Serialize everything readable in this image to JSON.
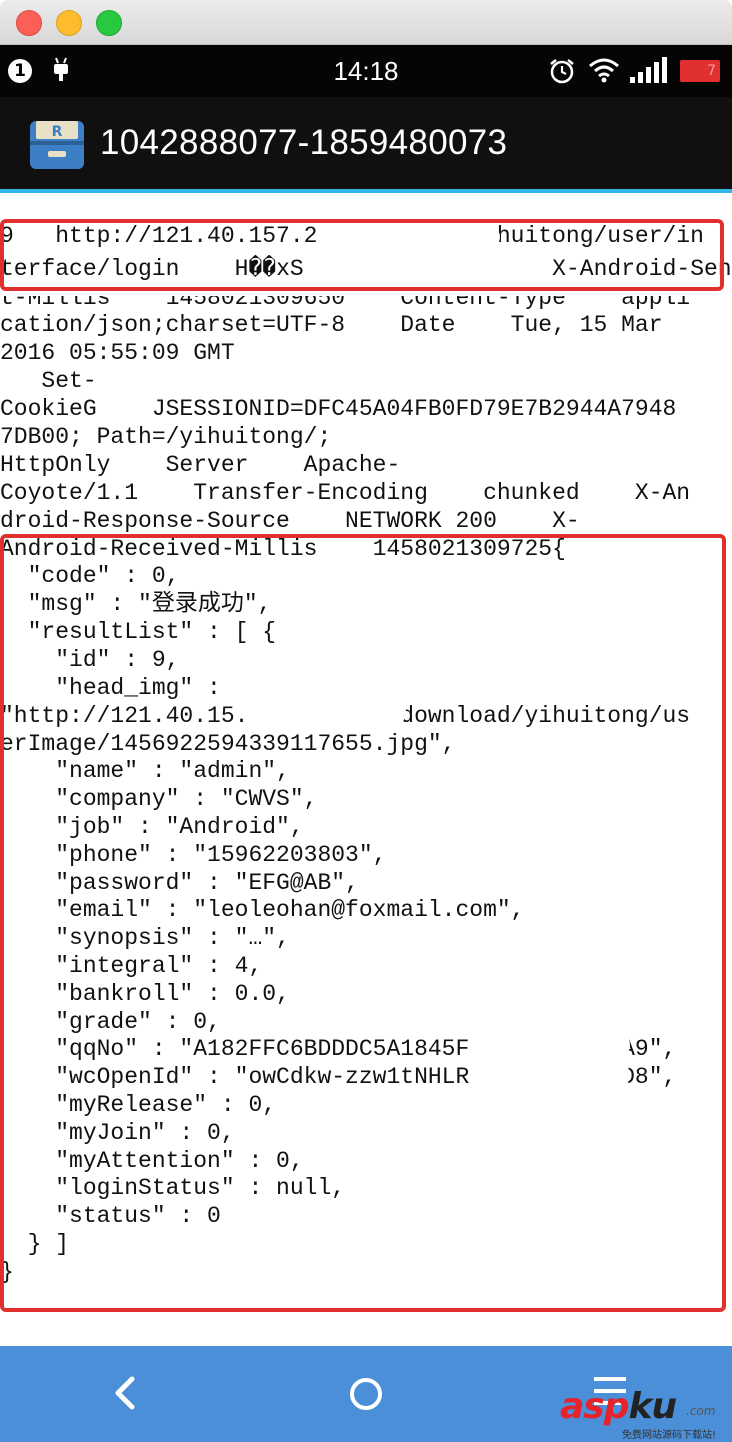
{
  "status_bar": {
    "notification_count": "1",
    "time": "14:18",
    "battery_level": "7"
  },
  "action_bar": {
    "title": "1042888077-1859480073"
  },
  "response_lines": [
    "9   http://121.40.157.2           yihuitong/user/in",
    "terface/login    H��xS                  X-Android-Sen",
    "t-Millis    1458021309650    Content-Type    appli",
    "cation/json;charset=UTF-8    Date    Tue, 15 Mar",
    "2016 05:55:09 GMT",
    "   Set-",
    "CookieG    JSESSIONID=DFC45A04FB0FD79E7B2944A7948",
    "7DB00; Path=/yihuitong/;",
    "HttpOnly    Server    Apache-",
    "Coyote/1.1    Transfer-Encoding    chunked    X-An",
    "droid-Response-Source    NETWORK 200    X-",
    "Android-Received-Millis    1458021309725{",
    "  \"code\" : 0,",
    "  \"msg\" : \"登录成功\",",
    "  \"resultList\" : [ {",
    "    \"id\" : 9,",
    "    \"head_img\" :",
    "\"http://121.40.15.          /download/yihuitong/us",
    "erImage/1456922594339117655.jpg\",",
    "    \"name\" : \"admin\",",
    "    \"company\" : \"CWVS\",",
    "    \"job\" : \"Android\",",
    "    \"phone\" : \"15962203803\",",
    "    \"password\" : \"EFG@AB\",",
    "    \"email\" : \"leoleohan@foxmail.com\",",
    "    \"synopsis\" : \"…\",",
    "    \"integral\" : 4,",
    "    \"bankroll\" : 0.0,",
    "    \"grade\" : 0,",
    "    \"qqNo\" : \"A182FFC6BDDDC5A1845F         BBA9\",",
    "    \"wcOpenId\" : \"owCdkw-zzw1tNHLR         Z4D8\",",
    "    \"myRelease\" : 0,",
    "    \"myJoin\" : 0,",
    "    \"myAttention\" : 0,",
    "    \"loginStatus\" : null,",
    "    \"status\" : 0",
    "  } ]",
    "}"
  ],
  "watermark": {
    "brand_asp": "asp",
    "brand_ku": "ku",
    "domain_suffix": ".com",
    "tagline": "免费网站源码下载站!"
  },
  "colors": {
    "action_bar_underline": "#33b5e5",
    "highlight_border": "#e0302e",
    "nav_bar": "#4a8fd8"
  }
}
